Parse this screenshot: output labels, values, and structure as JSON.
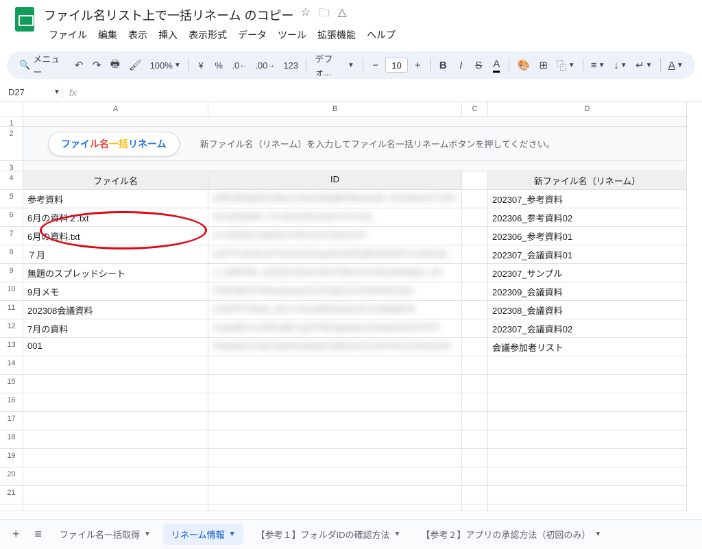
{
  "docTitle": "ファイル名リスト上で一括リネーム のコピー",
  "menubar": [
    "ファイル",
    "編集",
    "表示",
    "挿入",
    "表示形式",
    "データ",
    "ツール",
    "拡張機能",
    "ヘルプ"
  ],
  "toolbar": {
    "search": "メニュー",
    "zoom": "100%",
    "currency": "¥",
    "percent": "%",
    "dec_dec": ".0",
    "dec_inc": ".00",
    "numfmt": "123",
    "font": "デフォ...",
    "fontsize": "10"
  },
  "namebox": "D27",
  "columns": [
    "A",
    "B",
    "C",
    "D"
  ],
  "instruction": "新ファイル名（リネーム）を入力してファイル名一括リネームボタンを押してください。",
  "buttonParts": {
    "p1": "ファイ",
    "p2": "ル名",
    "p3": "一括",
    "p4": "リネーム"
  },
  "headers": {
    "a": "ファイル名",
    "b": "ID",
    "d": "新ファイル名（リネーム）"
  },
  "rows": [
    {
      "a": "参考資料",
      "b": "10R23RiqN25r4MnvLNQn3MjqBF8tKasrqR_h2mitiamKCVDU",
      "d": "202307_参考資料"
    },
    {
      "a": "6月の資料２.txt",
      "b": "1E1QOtahlS_TJLXjVHzErneqTnCFrS7g",
      "d": "202306_参考資料02"
    },
    {
      "a": "6月の資料.txt",
      "b": "1c-49z83C1j3pMzoY99-oZA-DhksUHY",
      "d": "202306_参考資料01"
    },
    {
      "a": "７月",
      "b": "1qX7CashIICarTrna4yAIJaogsDmtitTgMnHhk8lV1zVte65Jp",
      "d": "202307_会議資料01"
    },
    {
      "a": "無題のスプレッドシート",
      "b": "1_suMF9di_Jy2Q3m2Ae0rJkuFI39uXC318Lah62kgr3_oN",
      "d": "202307_サンプル"
    },
    {
      "a": "9月メモ",
      "b": "1h9aJi8SJi7kbau2pupuA1CNJqtLjTumK8mqkUqks",
      "d": "202309_会議資料"
    },
    {
      "a": "202308会議資料",
      "b": "1iJWt7PHMq2_a5s-oYjscteBhQ2jaLWTusrMtpBFW",
      "d": "202308_会議資料"
    },
    {
      "a": "7月の資料",
      "b": "1mqoMt7cLONE1BtLmg7PHEXjpdpka1ste3aHrdJUVCPY",
      "d": "202307_会議資料02"
    },
    {
      "a": "001",
      "b": "1tMqrt91YUALFg4HIzx82gar1h8k2vd-KUVFY91YCRws2r5k",
      "d": "会議参加者リスト"
    }
  ],
  "tabs": [
    {
      "label": "ファイル名一括取得",
      "active": false
    },
    {
      "label": "リネーム情報",
      "active": true
    },
    {
      "label": "【参考１】フォルダIDの確認方法",
      "active": false
    },
    {
      "label": "【参考２】アプリの承認方法（初回のみ）",
      "active": false
    }
  ]
}
